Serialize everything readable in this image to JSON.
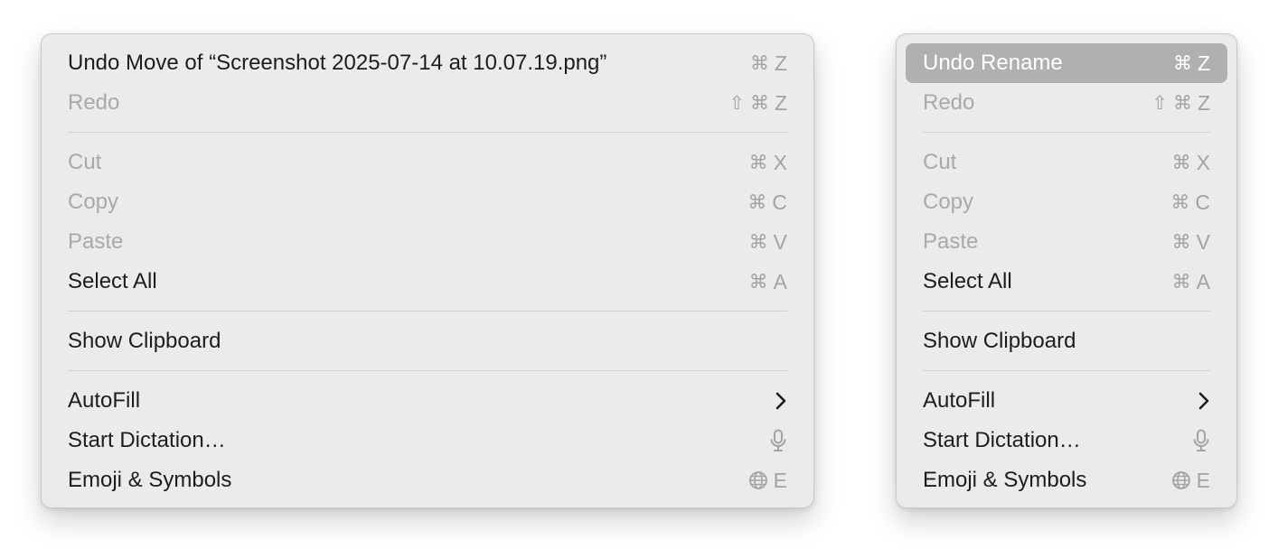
{
  "menus": [
    {
      "items": [
        {
          "label": "Undo Move of “Screenshot 2025-07-14 at 10.07.19.png”",
          "keys": [
            "⌘",
            "Z"
          ]
        },
        {
          "label": "Redo",
          "keys": [
            "⇧",
            "⌘",
            "Z"
          ]
        },
        {
          "label": "Cut",
          "keys": [
            "⌘",
            "X"
          ]
        },
        {
          "label": "Copy",
          "keys": [
            "⌘",
            "C"
          ]
        },
        {
          "label": "Paste",
          "keys": [
            "⌘",
            "V"
          ]
        },
        {
          "label": "Select All",
          "keys": [
            "⌘",
            "A"
          ]
        },
        {
          "label": "Show Clipboard"
        },
        {
          "label": "AutoFill",
          "icon": "chevron-right-icon"
        },
        {
          "label": "Start Dictation…",
          "icon": "microphone-icon"
        },
        {
          "label": "Emoji & Symbols",
          "icon": "globe-icon",
          "key": "E"
        }
      ]
    },
    {
      "items": [
        {
          "label": "Undo Rename",
          "keys": [
            "⌘",
            "Z"
          ],
          "state": "highlighted"
        },
        {
          "label": "Redo",
          "keys": [
            "⇧",
            "⌘",
            "Z"
          ]
        },
        {
          "label": "Cut",
          "keys": [
            "⌘",
            "X"
          ]
        },
        {
          "label": "Copy",
          "keys": [
            "⌘",
            "C"
          ]
        },
        {
          "label": "Paste",
          "keys": [
            "⌘",
            "V"
          ]
        },
        {
          "label": "Select All",
          "keys": [
            "⌘",
            "A"
          ]
        },
        {
          "label": "Show Clipboard"
        },
        {
          "label": "AutoFill",
          "icon": "chevron-right-icon"
        },
        {
          "label": "Start Dictation…",
          "icon": "microphone-icon"
        },
        {
          "label": "Emoji & Symbols",
          "icon": "globe-icon",
          "key": "E"
        }
      ]
    }
  ],
  "colors": {
    "menu_background": "#ebebeb",
    "highlight": "#b0b0b0",
    "enabled_text": "#1d1d1d",
    "disabled_text": "#a9a9a9"
  }
}
